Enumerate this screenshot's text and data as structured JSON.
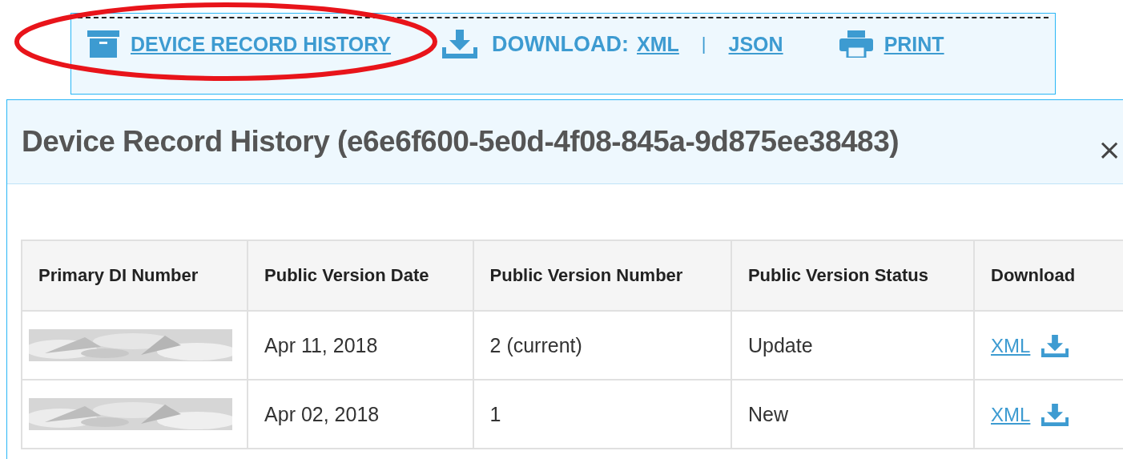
{
  "toolbar": {
    "history_link": "DEVICE RECORD HISTORY",
    "download_label": "DOWNLOAD:",
    "download_links": [
      "XML",
      "JSON"
    ],
    "separator": "|",
    "print_link": "PRINT",
    "highlighted": true
  },
  "modal": {
    "title": "Device Record History (e6e6f600-5e0d-4f08-845a-9d875ee38483)",
    "close": "×",
    "table": {
      "columns": [
        "Primary DI Number",
        "Public Version Date",
        "Public Version Number",
        "Public Version Status",
        "Download"
      ],
      "rows": [
        {
          "date": "Apr 11, 2018",
          "number": "2 (current)",
          "status": "Update",
          "download": "XML"
        },
        {
          "date": "Apr 02, 2018",
          "number": "1",
          "status": "New",
          "download": "XML"
        }
      ]
    }
  }
}
